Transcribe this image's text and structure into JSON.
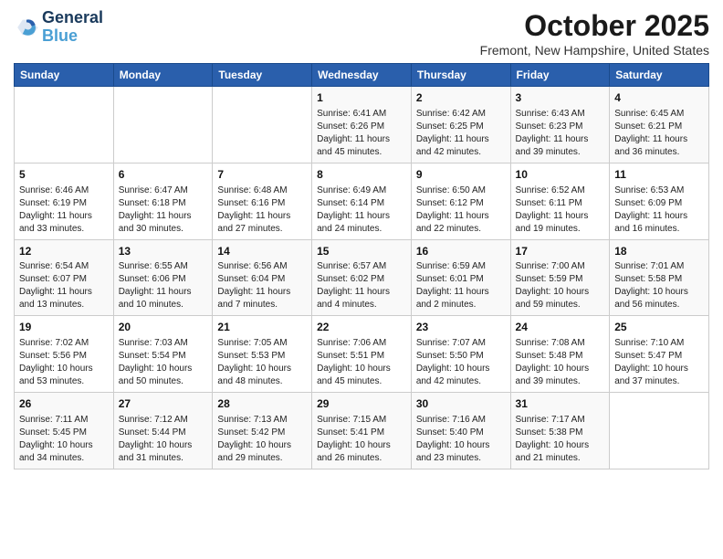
{
  "header": {
    "logo_line1": "General",
    "logo_line2": "Blue",
    "month": "October 2025",
    "location": "Fremont, New Hampshire, United States"
  },
  "days_of_week": [
    "Sunday",
    "Monday",
    "Tuesday",
    "Wednesday",
    "Thursday",
    "Friday",
    "Saturday"
  ],
  "weeks": [
    [
      {
        "day": "",
        "content": ""
      },
      {
        "day": "",
        "content": ""
      },
      {
        "day": "",
        "content": ""
      },
      {
        "day": "1",
        "content": "Sunrise: 6:41 AM\nSunset: 6:26 PM\nDaylight: 11 hours\nand 45 minutes."
      },
      {
        "day": "2",
        "content": "Sunrise: 6:42 AM\nSunset: 6:25 PM\nDaylight: 11 hours\nand 42 minutes."
      },
      {
        "day": "3",
        "content": "Sunrise: 6:43 AM\nSunset: 6:23 PM\nDaylight: 11 hours\nand 39 minutes."
      },
      {
        "day": "4",
        "content": "Sunrise: 6:45 AM\nSunset: 6:21 PM\nDaylight: 11 hours\nand 36 minutes."
      }
    ],
    [
      {
        "day": "5",
        "content": "Sunrise: 6:46 AM\nSunset: 6:19 PM\nDaylight: 11 hours\nand 33 minutes."
      },
      {
        "day": "6",
        "content": "Sunrise: 6:47 AM\nSunset: 6:18 PM\nDaylight: 11 hours\nand 30 minutes."
      },
      {
        "day": "7",
        "content": "Sunrise: 6:48 AM\nSunset: 6:16 PM\nDaylight: 11 hours\nand 27 minutes."
      },
      {
        "day": "8",
        "content": "Sunrise: 6:49 AM\nSunset: 6:14 PM\nDaylight: 11 hours\nand 24 minutes."
      },
      {
        "day": "9",
        "content": "Sunrise: 6:50 AM\nSunset: 6:12 PM\nDaylight: 11 hours\nand 22 minutes."
      },
      {
        "day": "10",
        "content": "Sunrise: 6:52 AM\nSunset: 6:11 PM\nDaylight: 11 hours\nand 19 minutes."
      },
      {
        "day": "11",
        "content": "Sunrise: 6:53 AM\nSunset: 6:09 PM\nDaylight: 11 hours\nand 16 minutes."
      }
    ],
    [
      {
        "day": "12",
        "content": "Sunrise: 6:54 AM\nSunset: 6:07 PM\nDaylight: 11 hours\nand 13 minutes."
      },
      {
        "day": "13",
        "content": "Sunrise: 6:55 AM\nSunset: 6:06 PM\nDaylight: 11 hours\nand 10 minutes."
      },
      {
        "day": "14",
        "content": "Sunrise: 6:56 AM\nSunset: 6:04 PM\nDaylight: 11 hours\nand 7 minutes."
      },
      {
        "day": "15",
        "content": "Sunrise: 6:57 AM\nSunset: 6:02 PM\nDaylight: 11 hours\nand 4 minutes."
      },
      {
        "day": "16",
        "content": "Sunrise: 6:59 AM\nSunset: 6:01 PM\nDaylight: 11 hours\nand 2 minutes."
      },
      {
        "day": "17",
        "content": "Sunrise: 7:00 AM\nSunset: 5:59 PM\nDaylight: 10 hours\nand 59 minutes."
      },
      {
        "day": "18",
        "content": "Sunrise: 7:01 AM\nSunset: 5:58 PM\nDaylight: 10 hours\nand 56 minutes."
      }
    ],
    [
      {
        "day": "19",
        "content": "Sunrise: 7:02 AM\nSunset: 5:56 PM\nDaylight: 10 hours\nand 53 minutes."
      },
      {
        "day": "20",
        "content": "Sunrise: 7:03 AM\nSunset: 5:54 PM\nDaylight: 10 hours\nand 50 minutes."
      },
      {
        "day": "21",
        "content": "Sunrise: 7:05 AM\nSunset: 5:53 PM\nDaylight: 10 hours\nand 48 minutes."
      },
      {
        "day": "22",
        "content": "Sunrise: 7:06 AM\nSunset: 5:51 PM\nDaylight: 10 hours\nand 45 minutes."
      },
      {
        "day": "23",
        "content": "Sunrise: 7:07 AM\nSunset: 5:50 PM\nDaylight: 10 hours\nand 42 minutes."
      },
      {
        "day": "24",
        "content": "Sunrise: 7:08 AM\nSunset: 5:48 PM\nDaylight: 10 hours\nand 39 minutes."
      },
      {
        "day": "25",
        "content": "Sunrise: 7:10 AM\nSunset: 5:47 PM\nDaylight: 10 hours\nand 37 minutes."
      }
    ],
    [
      {
        "day": "26",
        "content": "Sunrise: 7:11 AM\nSunset: 5:45 PM\nDaylight: 10 hours\nand 34 minutes."
      },
      {
        "day": "27",
        "content": "Sunrise: 7:12 AM\nSunset: 5:44 PM\nDaylight: 10 hours\nand 31 minutes."
      },
      {
        "day": "28",
        "content": "Sunrise: 7:13 AM\nSunset: 5:42 PM\nDaylight: 10 hours\nand 29 minutes."
      },
      {
        "day": "29",
        "content": "Sunrise: 7:15 AM\nSunset: 5:41 PM\nDaylight: 10 hours\nand 26 minutes."
      },
      {
        "day": "30",
        "content": "Sunrise: 7:16 AM\nSunset: 5:40 PM\nDaylight: 10 hours\nand 23 minutes."
      },
      {
        "day": "31",
        "content": "Sunrise: 7:17 AM\nSunset: 5:38 PM\nDaylight: 10 hours\nand 21 minutes."
      },
      {
        "day": "",
        "content": ""
      }
    ]
  ]
}
